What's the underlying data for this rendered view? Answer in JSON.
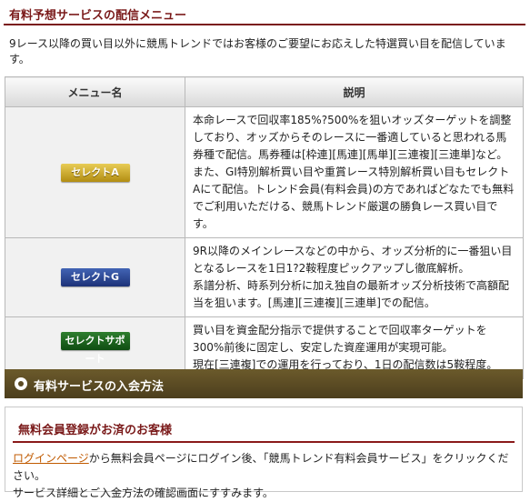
{
  "section_title": "有料予想サービスの配信メニュー",
  "intro": "9レース以降の買い目以外に競馬トレンドではお客様のご要望にお応えした特選買い目を配信しています。",
  "table": {
    "header_name": "メニュー名",
    "header_desc": "説明",
    "rows": [
      {
        "name": "セレクトA",
        "color": "#c8a22a",
        "lines": [
          "本命レースで回収率185%?500%を狙いオッズターゲットを調整しており、オッズからそのレースに一番適していると思われる馬券種で配信。馬券種は[枠連][馬連][馬単][三連複][三連単]など。",
          "また、GI特別解析買い目や重賞レース特別解析買い目もセレクトAにて配信。トレンド会員(有料会員)の方であればどなたでも無料でご利用いただける、競馬トレンド厳選の勝負レース買い目です。"
        ]
      },
      {
        "name": "セレクトG",
        "color": "#2a4595",
        "lines": [
          "9R以降のメインレースなどの中から、オッズ分析的に一番狙い目となるレースを1日1?2鞍程度ピックアップし徹底解析。",
          "系譜分析、時系列分析に加え独自の最新オッズ分析技術で高額配当を狙います。[馬連][三連複][三連単]での配信。"
        ]
      },
      {
        "name": "セレクトサポート",
        "color": "#1a5e1a",
        "lines": [
          "買い目を資金配分指示で提供することで回収率ターゲットを300%前後に固定し、安定した資産運用が実現可能。",
          "現在[三連複]での運用を行っており、1日の配信数は5鞍程度。"
        ]
      }
    ]
  },
  "join_title": "有料サービスの入会方法",
  "box": {
    "title": "無料会員登録がお済のお客様",
    "link_text": "ログインページ",
    "text_after_link": "から無料会員ページにログイン後、「競馬トレンド有料会員サービス」をクリックください。",
    "line2": "サービス詳細とご入金方法の確認画面にすすみます。"
  }
}
